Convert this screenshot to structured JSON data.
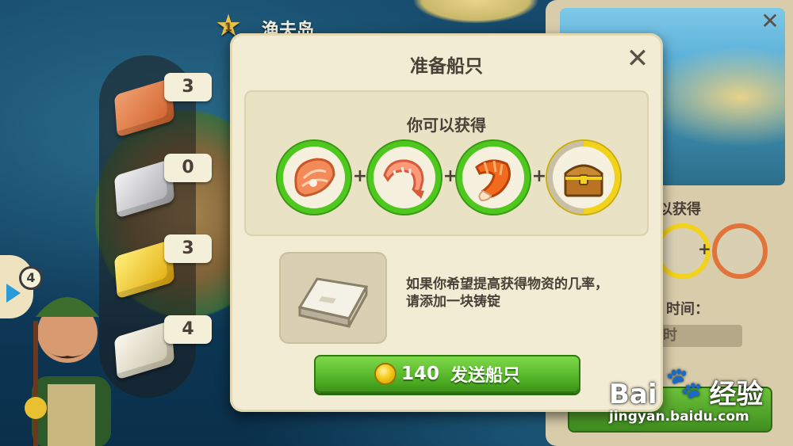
{
  "map": {
    "island_name": "渔夫岛",
    "level": "1"
  },
  "ingots": [
    {
      "kind": "copper-ingot",
      "count": "3",
      "color": "#e0743a"
    },
    {
      "kind": "silver-ingot",
      "count": "0",
      "color": "#c9c9cc"
    },
    {
      "kind": "gold-ingot",
      "count": "3",
      "color": "#f2c21a"
    },
    {
      "kind": "platinum-ingot",
      "count": "4",
      "color": "#e2dcc8"
    }
  ],
  "side_tab": {
    "count": "4"
  },
  "background_panel": {
    "gain_label": "以获得",
    "time_label": "时间：",
    "time_value": "时"
  },
  "dialog": {
    "title": "准备船只",
    "rewards_label": "你可以获得",
    "rewards": [
      {
        "icon": "salmon-steak-icon",
        "progress": 1.0
      },
      {
        "icon": "shrimp-icon",
        "progress": 1.0
      },
      {
        "icon": "lobster-tail-icon",
        "progress": 1.0
      },
      {
        "icon": "treasure-chest-icon",
        "progress": 0.5
      }
    ],
    "ingot_hint": "如果你希望提高获得物资的几率，请添加一块铸锭",
    "send_cost": "140",
    "send_label": "发送船只"
  },
  "watermark": {
    "brand": "Bai",
    "brand_suffix": "经验",
    "url": "jingyan.baidu.com"
  },
  "colors": {
    "accent_green": "#56b92a",
    "ring_complete": "#4ec81e",
    "ring_partial": "#f2d21a",
    "dialog_bg": "#f3ecd4"
  }
}
